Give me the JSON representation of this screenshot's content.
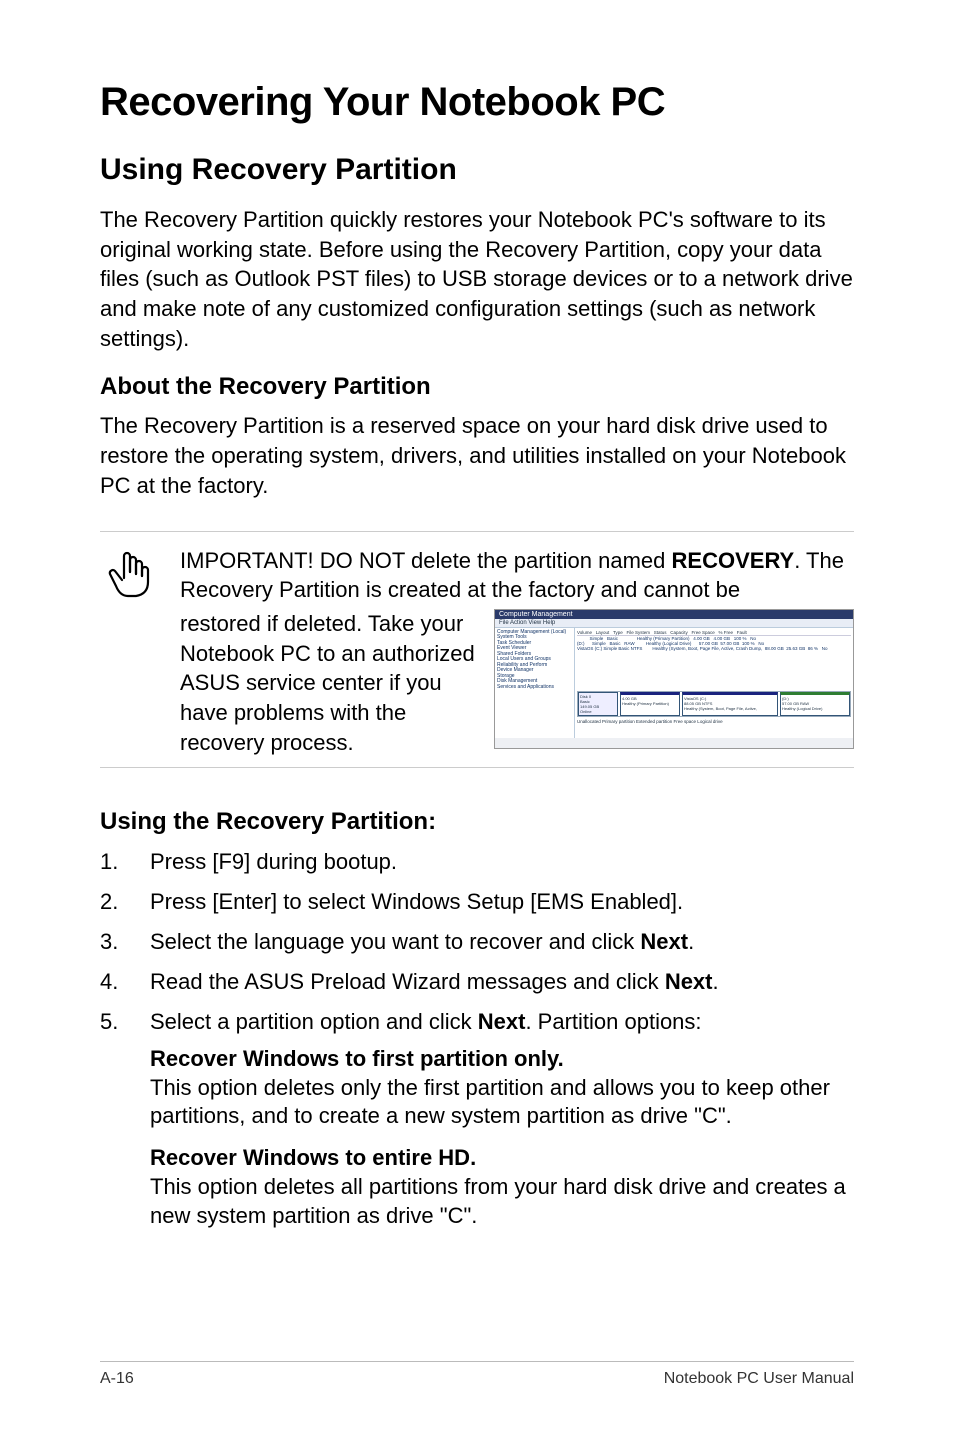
{
  "title": "Recovering Your Notebook PC",
  "section1": {
    "heading": "Using Recovery Partition",
    "para": "The Recovery Partition quickly restores your Notebook PC's software to its original working state. Before using the Recovery Partition, copy your data files (such as Outlook PST files) to USB storage devices or to a network drive and make note of any customized configuration settings (such as network settings)."
  },
  "about": {
    "heading": "About the Recovery Partition",
    "para": "The Recovery Partition is a reserved space on your hard disk drive used to restore the operating system, drivers, and utilities installed on your Notebook PC at the factory."
  },
  "important": {
    "lead": "IMPORTANT! DO NOT delete the partition named ",
    "bold": "RECOVERY",
    "tail": ". The Recovery Partition is created at the factory and cannot be ",
    "lower": "restored if deleted. Take your Notebook PC to an authorized ASUS service center if you have problems with the recovery process."
  },
  "screenshot": {
    "window_title": "Computer Management",
    "menu": "File   Action   View   Help",
    "tree": "Computer Management (Local)\n  System Tools\n    Task Scheduler\n    Event Viewer\n    Shared Folders\n    Local Users and Groups\n    Reliability and Perform\n    Device Manager\n  Storage\n    Disk Management\n  Services and Applications",
    "vol_header": "Volume   Layout   Type   File System   Status   Capacity   Free Space   % Free   Fault",
    "vol_rows": "          Simple   Basic               Healthy (Primary Partition)   4.00 GB   4.00 GB   100 %   No\n(D:)      Simple   Basic   RAW         Healthy (Logical Drive)      57.00 GB  57.00 GB  100 %   No\nVistaOS (C:) Simple Basic NTFS        Healthy (System, Boot, Page File, Active, Crash Dump,  88.00 GB  25.63 GB  86 %   No",
    "disk0": "Disk 0\nBasic\n149.05 GB\nOnline",
    "seg1": "4.00 GB\nHealthy (Primary Partition)",
    "seg2": "VistaOS (C:)\n88.05 GB NTFS\nHealthy (System, Boot, Page File, Active,",
    "seg3": "(D:)\n57.00 GB RAW\nHealthy (Logical Drive)",
    "legend": "Unallocated   Primary partition   Extended partition   Free space   Logical drive"
  },
  "using": {
    "heading": "Using the Recovery Partition:",
    "steps": {
      "s1": "Press [F9] during bootup.",
      "s2": "Press [Enter] to select Windows Setup [EMS Enabled].",
      "s3_a": "Select the language you want to recover and click ",
      "s3_b": "Next",
      "s3_c": ".",
      "s4_a": "Read the ASUS Preload Wizard messages and click ",
      "s4_b": "Next",
      "s4_c": ".",
      "s5_a": "Select a partition option and click ",
      "s5_b": "Next",
      "s5_c": ". Partition options:"
    },
    "opt1_h": "Recover Windows to first partition only.",
    "opt1_p": "This option deletes only the first partition and allows you to keep other partitions, and to create a new system partition as drive \"C\".",
    "opt2_h": "Recover Windows to entire HD.",
    "opt2_p": "This option deletes all partitions from your hard disk drive and creates a new system partition as drive \"C\"."
  },
  "footer": {
    "left": "A-16",
    "right": "Notebook PC User Manual"
  }
}
